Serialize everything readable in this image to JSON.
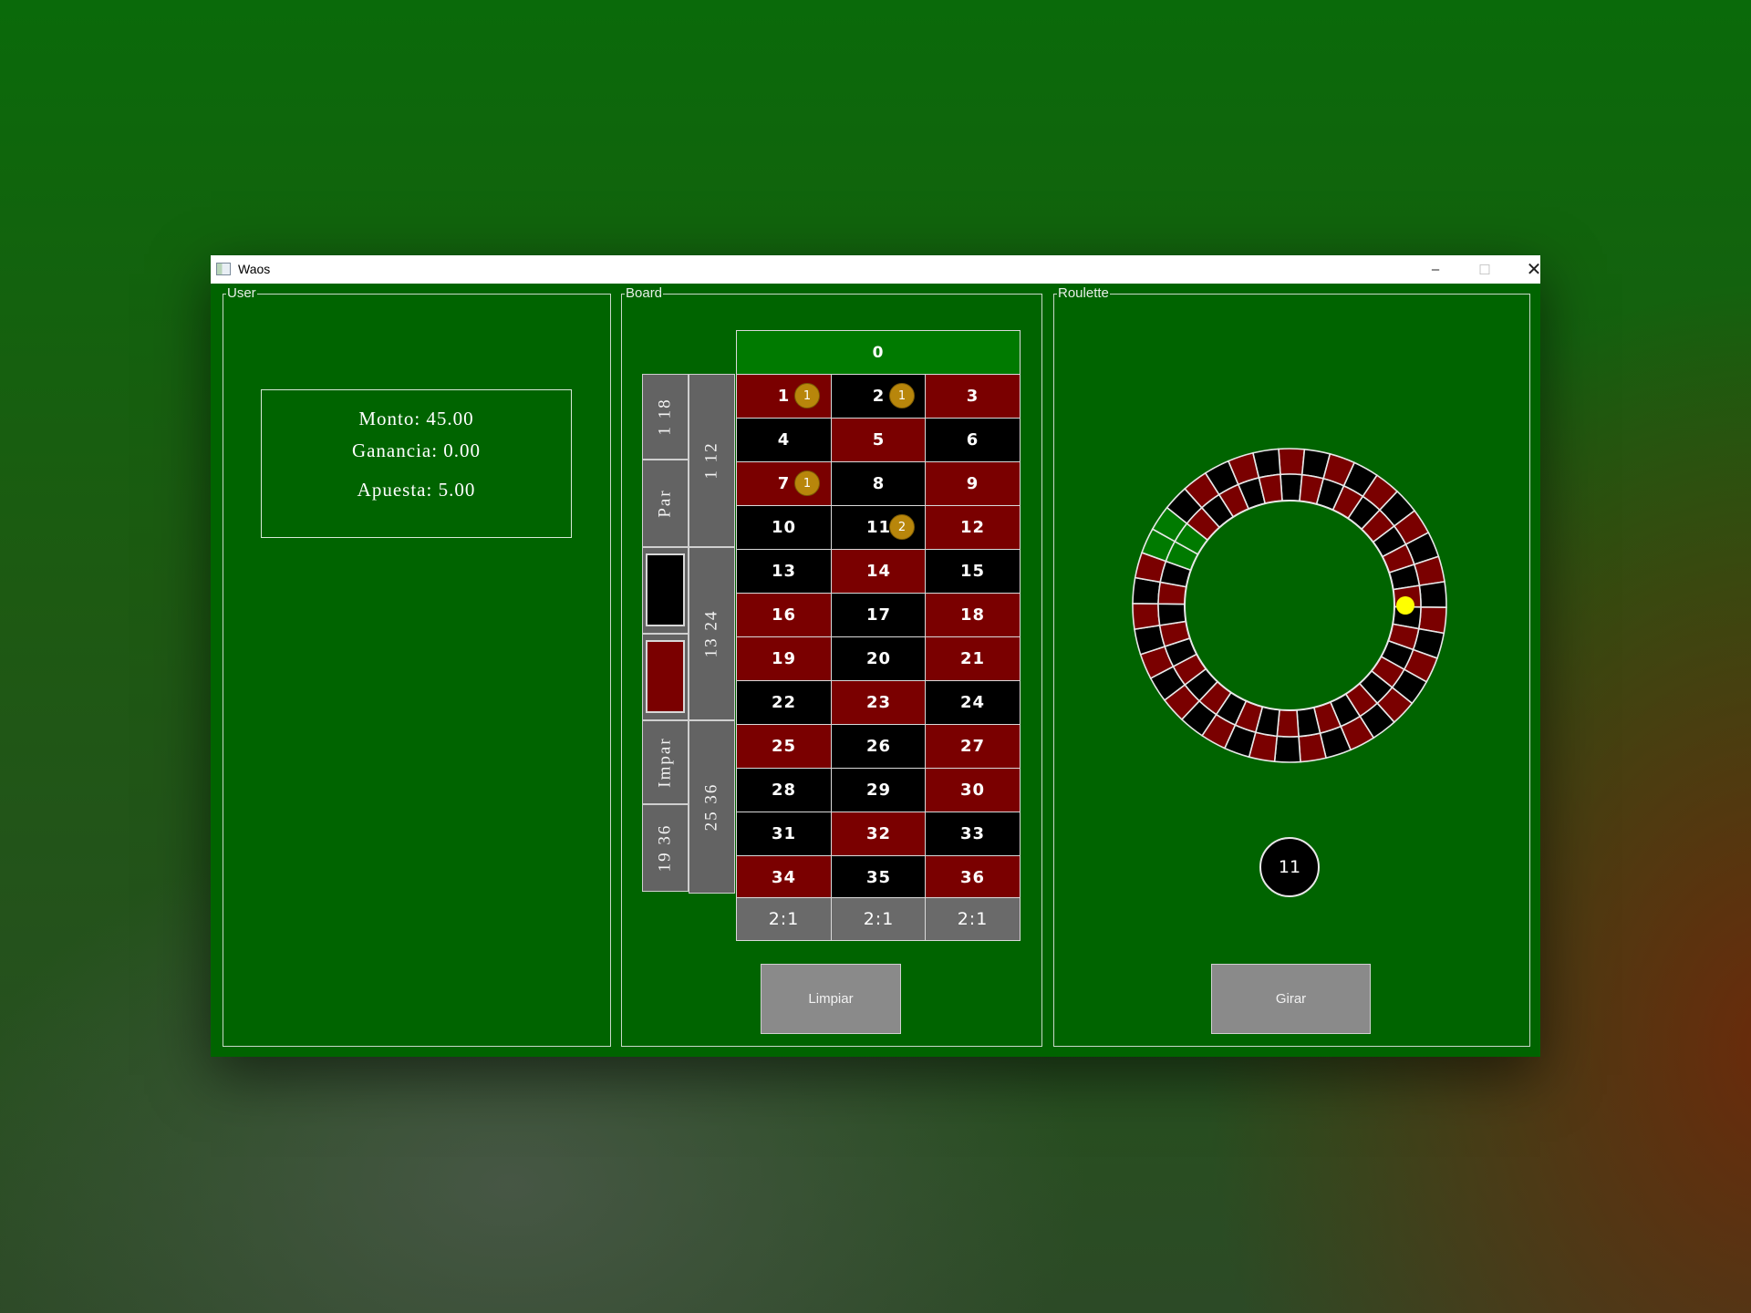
{
  "window": {
    "title": "Waos",
    "minimize_glyph": "–",
    "maximize_glyph": "☐",
    "close_glyph": "✕"
  },
  "user": {
    "group_label": "User",
    "monto": "Monto: 45.00",
    "ganancia": "Ganancia: 0.00",
    "apuesta": "Apuesta: 5.00"
  },
  "board": {
    "group_label": "Board",
    "zero": "0",
    "rows": [
      [
        {
          "n": "1",
          "c": "red"
        },
        {
          "n": "2",
          "c": "black"
        },
        {
          "n": "3",
          "c": "red"
        }
      ],
      [
        {
          "n": "4",
          "c": "black"
        },
        {
          "n": "5",
          "c": "red"
        },
        {
          "n": "6",
          "c": "black"
        }
      ],
      [
        {
          "n": "7",
          "c": "red"
        },
        {
          "n": "8",
          "c": "black"
        },
        {
          "n": "9",
          "c": "red"
        }
      ],
      [
        {
          "n": "10",
          "c": "black"
        },
        {
          "n": "11",
          "c": "black"
        },
        {
          "n": "12",
          "c": "red"
        }
      ],
      [
        {
          "n": "13",
          "c": "black"
        },
        {
          "n": "14",
          "c": "red"
        },
        {
          "n": "15",
          "c": "black"
        }
      ],
      [
        {
          "n": "16",
          "c": "red"
        },
        {
          "n": "17",
          "c": "black"
        },
        {
          "n": "18",
          "c": "red"
        }
      ],
      [
        {
          "n": "19",
          "c": "red"
        },
        {
          "n": "20",
          "c": "black"
        },
        {
          "n": "21",
          "c": "red"
        }
      ],
      [
        {
          "n": "22",
          "c": "black"
        },
        {
          "n": "23",
          "c": "red"
        },
        {
          "n": "24",
          "c": "black"
        }
      ],
      [
        {
          "n": "25",
          "c": "red"
        },
        {
          "n": "26",
          "c": "black"
        },
        {
          "n": "27",
          "c": "red"
        }
      ],
      [
        {
          "n": "28",
          "c": "black"
        },
        {
          "n": "29",
          "c": "black"
        },
        {
          "n": "30",
          "c": "red"
        }
      ],
      [
        {
          "n": "31",
          "c": "black"
        },
        {
          "n": "32",
          "c": "red"
        },
        {
          "n": "33",
          "c": "black"
        }
      ],
      [
        {
          "n": "34",
          "c": "red"
        },
        {
          "n": "35",
          "c": "black"
        },
        {
          "n": "36",
          "c": "red"
        }
      ]
    ],
    "columns": [
      "2:1",
      "2:1",
      "2:1"
    ],
    "outside": {
      "low": "1 18",
      "even": "Par",
      "odd": "Impar",
      "high": "19 36"
    },
    "dozens": [
      "1 12",
      "13 24",
      "25 36"
    ],
    "chips": [
      {
        "number": "1",
        "amount": "1"
      },
      {
        "number": "2",
        "amount": "1"
      },
      {
        "number": "7",
        "amount": "1"
      },
      {
        "number": "11",
        "amount": "2"
      }
    ],
    "clear_button": "Limpiar"
  },
  "roulette": {
    "group_label": "Roulette",
    "result": "11",
    "spin_button": "Girar",
    "ball_color": "#ffff00",
    "pocket_count": 38,
    "green_pocket_index": 31,
    "ball_angle_deg": 0
  },
  "colors": {
    "felt": "#006400",
    "red": "#7a0000",
    "black": "#000000",
    "green": "#007a00",
    "chip": "#b8860b"
  }
}
